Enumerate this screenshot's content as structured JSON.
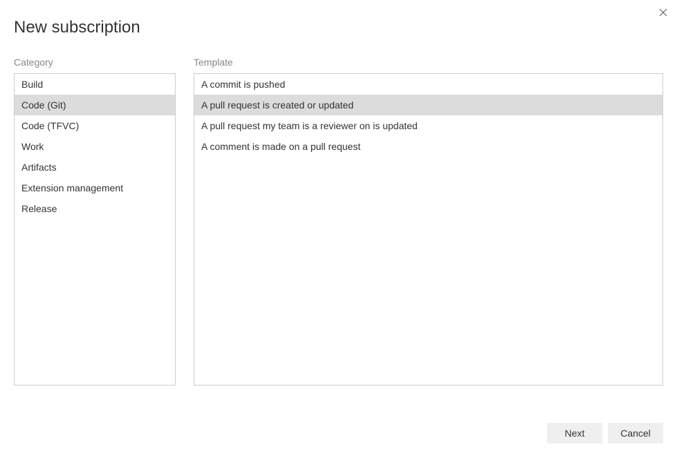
{
  "dialog": {
    "title": "New subscription"
  },
  "category": {
    "header": "Category",
    "items": [
      {
        "label": "Build",
        "selected": false
      },
      {
        "label": "Code (Git)",
        "selected": true
      },
      {
        "label": "Code (TFVC)",
        "selected": false
      },
      {
        "label": "Work",
        "selected": false
      },
      {
        "label": "Artifacts",
        "selected": false
      },
      {
        "label": "Extension management",
        "selected": false
      },
      {
        "label": "Release",
        "selected": false
      }
    ]
  },
  "template": {
    "header": "Template",
    "items": [
      {
        "label": "A commit is pushed",
        "selected": false
      },
      {
        "label": "A pull request is created or updated",
        "selected": true
      },
      {
        "label": "A pull request my team is a reviewer on is updated",
        "selected": false
      },
      {
        "label": "A comment is made on a pull request",
        "selected": false
      }
    ]
  },
  "footer": {
    "next_label": "Next",
    "cancel_label": "Cancel"
  }
}
